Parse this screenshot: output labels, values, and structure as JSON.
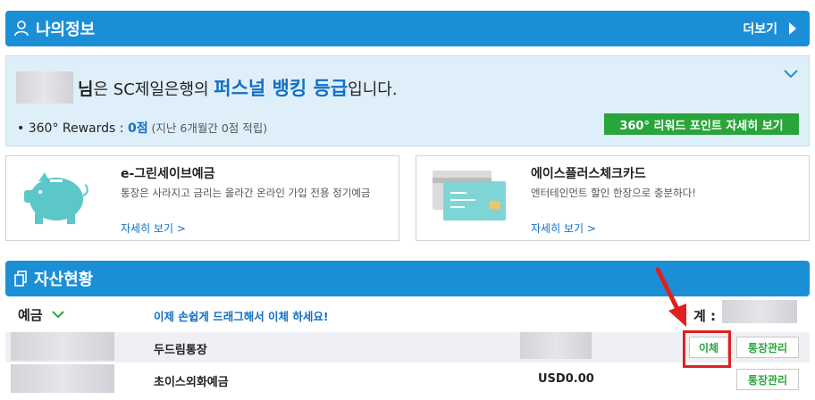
{
  "myinfo": {
    "title": "나의정보",
    "more_label": "더보기",
    "grade": {
      "nim": "님",
      "mid": "은 SC제일은행의 ",
      "grade_name": "퍼스널 뱅킹 등급",
      "end": "입니다."
    },
    "rewards": {
      "label": "360° Rewards : ",
      "points": "0점",
      "sub": " (지난 6개월간 0점 적립)",
      "button_label": "360° 리워드 포인트 자세히 보기"
    }
  },
  "promos": [
    {
      "title": "e-그린세이브예금",
      "desc": "통장은 사라지고 금리는 올라간 온라인 가입 전용 정기예금",
      "link": "자세히 보기 >",
      "icon": "piggy-bank-icon"
    },
    {
      "title": "에이스플러스체크카드",
      "desc": "엔터테인먼트 할인 한장으로 충분하다!",
      "link": "자세히 보기 >",
      "icon": "credit-card-icon"
    }
  ],
  "assets": {
    "title": "자산현황",
    "deposit_label": "예금",
    "drag_hint": "이제 손쉽게 드래그해서 이체 하세요!",
    "total_label": "계 :",
    "accounts": [
      {
        "name": "두드림통장",
        "balance": "",
        "transfer_label": "이체",
        "manage_label": "통장관리"
      },
      {
        "name": "초이스외화예금",
        "balance": "USD0.00",
        "manage_label": "통장관리"
      }
    ]
  },
  "colors": {
    "brand_blue": "#1b8fd6",
    "accent_green": "#2aa53b",
    "highlight_red": "#e02020"
  }
}
